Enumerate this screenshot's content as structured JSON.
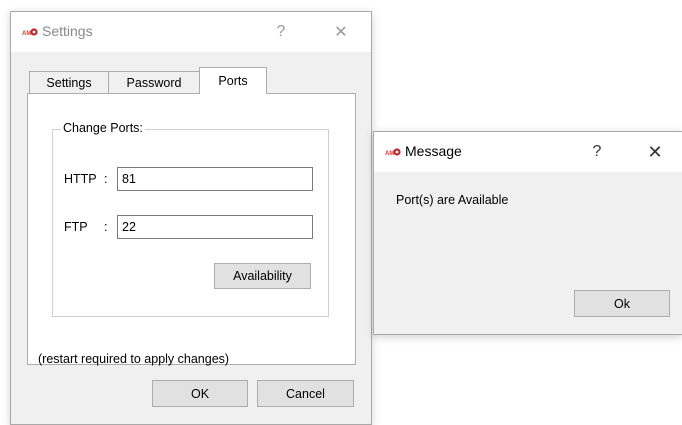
{
  "settings_dialog": {
    "title": "Settings",
    "help_glyph": "?",
    "close_glyph": "✕",
    "tabs": [
      {
        "label": "Settings",
        "active": false
      },
      {
        "label": "Password",
        "active": false
      },
      {
        "label": "Ports",
        "active": true
      }
    ],
    "group_title": "Change Ports:",
    "http_label": "HTTP",
    "ftp_label": "FTP",
    "colon": ":",
    "http_value": "81",
    "ftp_value": "22",
    "availability_button": "Availability",
    "note": "(restart required to apply changes)",
    "ok_button": "OK",
    "cancel_button": "Cancel"
  },
  "message_dialog": {
    "title": "Message",
    "help_glyph": "?",
    "close_glyph": "✕",
    "text": "Port(s) are Available",
    "ok_button": "Ok"
  },
  "icons": {
    "app_icon": "app-logo-icon",
    "help": "help-icon",
    "close": "close-icon"
  },
  "colors": {
    "app_icon_text": "#e8332a",
    "app_icon_ring": "#c0272d",
    "client_background": "#f0f0f0",
    "button_face": "#e1e1e1"
  }
}
